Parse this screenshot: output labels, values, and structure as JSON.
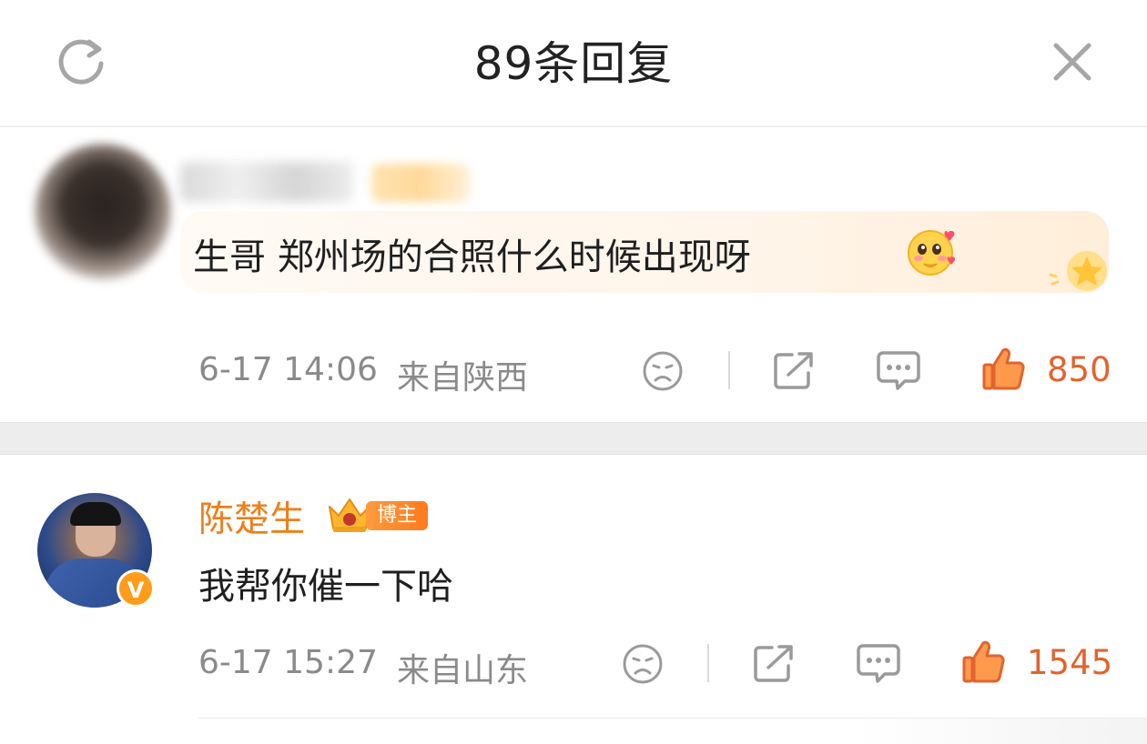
{
  "header": {
    "title": "89条回复"
  },
  "comments": [
    {
      "text": "生哥 郑州场的合照什么时候出现呀",
      "date": "6-17 14:06",
      "location": "来自陕西",
      "likes": "850",
      "emoji_icon": "shy-face-emoji"
    },
    {
      "author": "陈楚生",
      "author_badge": "博主",
      "verified_badge": "V",
      "text": "我帮你催一下哈",
      "date": "6-17 15:27",
      "location": "来自山东",
      "likes": "1545"
    }
  ],
  "colors": {
    "accent": "#ee7f1a",
    "like": "#e2632e",
    "meta": "#8a8a8a",
    "icon": "#9a9a9a"
  }
}
